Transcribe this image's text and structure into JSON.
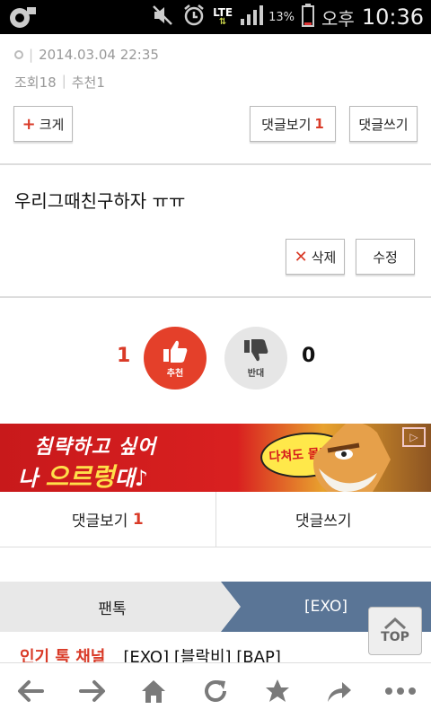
{
  "status_bar": {
    "network": "LTE",
    "battery_percent": "13%",
    "clock_label": "오후",
    "time": "10:36"
  },
  "post_meta": {
    "date": "2014.03.04 22:35",
    "views": "조회18",
    "recommend": "추천1"
  },
  "toolbar": {
    "enlarge_label": "크게",
    "view_comments_label": "댓글보기",
    "comment_count": "1",
    "write_comment_label": "댓글쓰기"
  },
  "content": {
    "text": "우리그때친구하자 ㅠㅠ",
    "delete_label": "삭제",
    "edit_label": "수정"
  },
  "votes": {
    "up_count": "1",
    "up_label": "추천",
    "down_label": "반대",
    "down_count": "0"
  },
  "banner": {
    "line1": "침략하고 싶어",
    "line2_a": "나 ",
    "line2_b": "으르렁",
    "line2_c": "대♪",
    "bubble": "다쳐도 몰라~"
  },
  "comment_tabs": {
    "view_label": "댓글보기",
    "view_count": "1",
    "write_label": "댓글쓰기"
  },
  "channel_tabs": {
    "left": "팬톡",
    "right": "[EXO]"
  },
  "popular": {
    "label": "인기 톡 채널",
    "names": "[EXO] [블락비] [BAP]"
  },
  "top_button": {
    "label": "TOP"
  },
  "nav": [
    "back-icon",
    "forward-icon",
    "home-icon",
    "refresh-icon",
    "star-icon",
    "share-icon",
    "more-icon"
  ],
  "colors": {
    "accent_red": "#d93a27",
    "channel_blue": "#5a7596"
  }
}
